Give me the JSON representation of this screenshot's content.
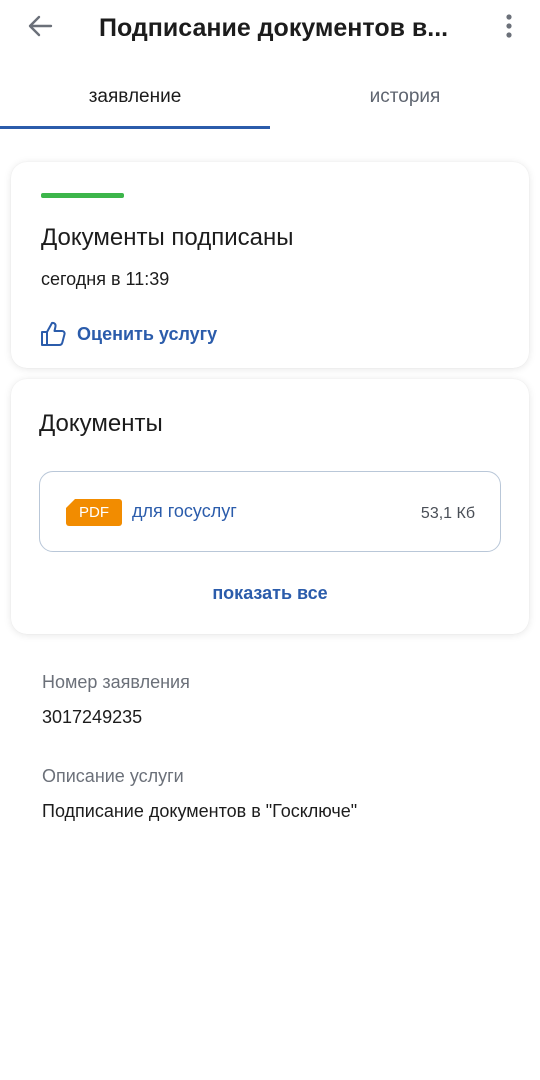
{
  "header": {
    "title": "Подписание документов в...",
    "back_icon": "arrow-left-icon",
    "menu_icon": "more-vertical-icon"
  },
  "tabs": [
    {
      "label": "заявление",
      "active": true
    },
    {
      "label": "история",
      "active": false
    }
  ],
  "status_card": {
    "title": "Документы подписаны",
    "time": "сегодня в 11:39",
    "rate_label": "Оценить услугу",
    "rate_icon": "thumbs-up-icon",
    "status_color": "#3cb54a"
  },
  "documents_card": {
    "title": "Документы",
    "items": [
      {
        "badge": "PDF",
        "name": "для госуслуг",
        "size": "53,1 Кб"
      }
    ],
    "show_all_label": "показать все"
  },
  "info": {
    "number_label": "Номер заявления",
    "number_value": "3017249235",
    "description_label": "Описание услуги",
    "description_value": "Подписание документов в \"Госключе\""
  },
  "colors": {
    "accent": "#2b5cab",
    "pdf_badge": "#f28c00",
    "success": "#3cb54a"
  }
}
